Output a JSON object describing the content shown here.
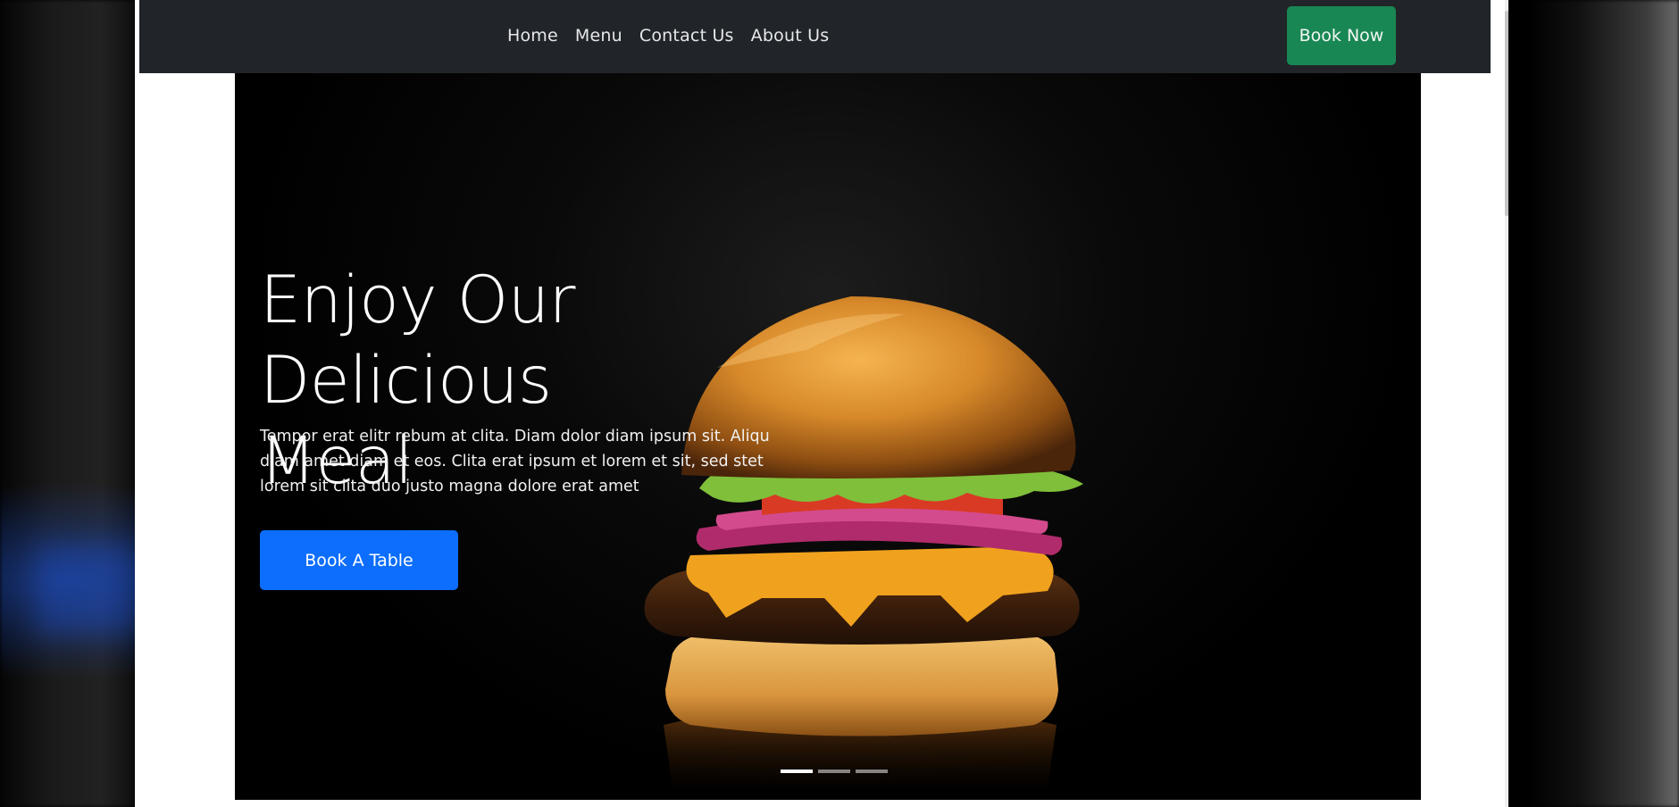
{
  "nav": {
    "links": [
      "Home",
      "Menu",
      "Contact Us",
      "About Us"
    ],
    "cta_label": "Book Now"
  },
  "hero": {
    "title_line_1": "Enjoy Our",
    "title_line_2": "Delicious Meal",
    "description": "Tempor erat elitr rebum at clita. Diam dolor diam ipsum sit. Aliqu diam amet diam et eos. Clita erat ipsum et lorem et sit, sed stet lorem sit clita duo justo magna dolore erat amet",
    "button_label": "Book A Table",
    "slide_count": 3,
    "active_slide": 1
  },
  "colors": {
    "navbar_bg": "#212529",
    "book_now_bg": "#198754",
    "book_table_bg": "#0d6efd"
  },
  "icons": {
    "hero_image": "burger-image"
  }
}
